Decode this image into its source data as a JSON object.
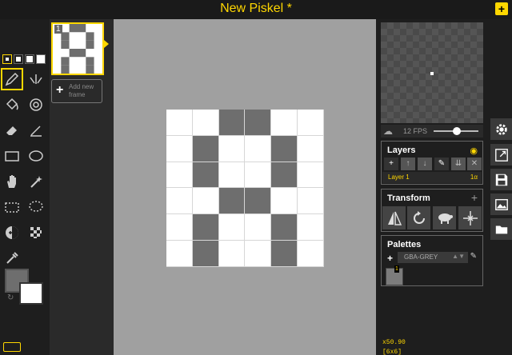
{
  "app": {
    "title": "New Piskel *",
    "new_button_label": "+"
  },
  "frames": {
    "items": [
      {
        "number": "1"
      }
    ],
    "add_frame_label": "Add new frame"
  },
  "preview": {
    "fps_label": "12 FPS",
    "fps_value": 12
  },
  "layers": {
    "title": "Layers",
    "buttons": [
      "+",
      "↑",
      "↓",
      "✎",
      "⇊",
      "✕"
    ],
    "items": [
      {
        "name": "Layer 1",
        "opacity": "1α"
      }
    ]
  },
  "transform": {
    "title": "Transform",
    "add_label": "+",
    "tools": [
      "flip-icon",
      "rotate-icon",
      "clone-icon",
      "center-icon"
    ]
  },
  "palettes": {
    "title": "Palettes",
    "add_label": "+",
    "selected": "GBA-GREY",
    "arrows": "▲▼",
    "swatches": [
      {
        "number": "1",
        "color": "#7c7c7c"
      }
    ]
  },
  "status": {
    "zoom": "x50.90",
    "dimensions": "[6x6]"
  },
  "colors": {
    "primary": "#6e6e6e",
    "secondary": "#ffffff",
    "accent": "#ffd700",
    "pixel_dark": "#6e6e6e",
    "pixel_light": "#ffffff"
  },
  "canvas": {
    "width": 6,
    "height": 6,
    "pixels": [
      [
        0,
        0,
        1,
        1,
        0,
        0
      ],
      [
        0,
        1,
        0,
        0,
        1,
        0
      ],
      [
        0,
        1,
        0,
        0,
        1,
        0
      ],
      [
        0,
        0,
        1,
        1,
        0,
        0
      ],
      [
        0,
        1,
        0,
        0,
        1,
        0
      ],
      [
        0,
        1,
        0,
        0,
        1,
        0
      ]
    ]
  }
}
